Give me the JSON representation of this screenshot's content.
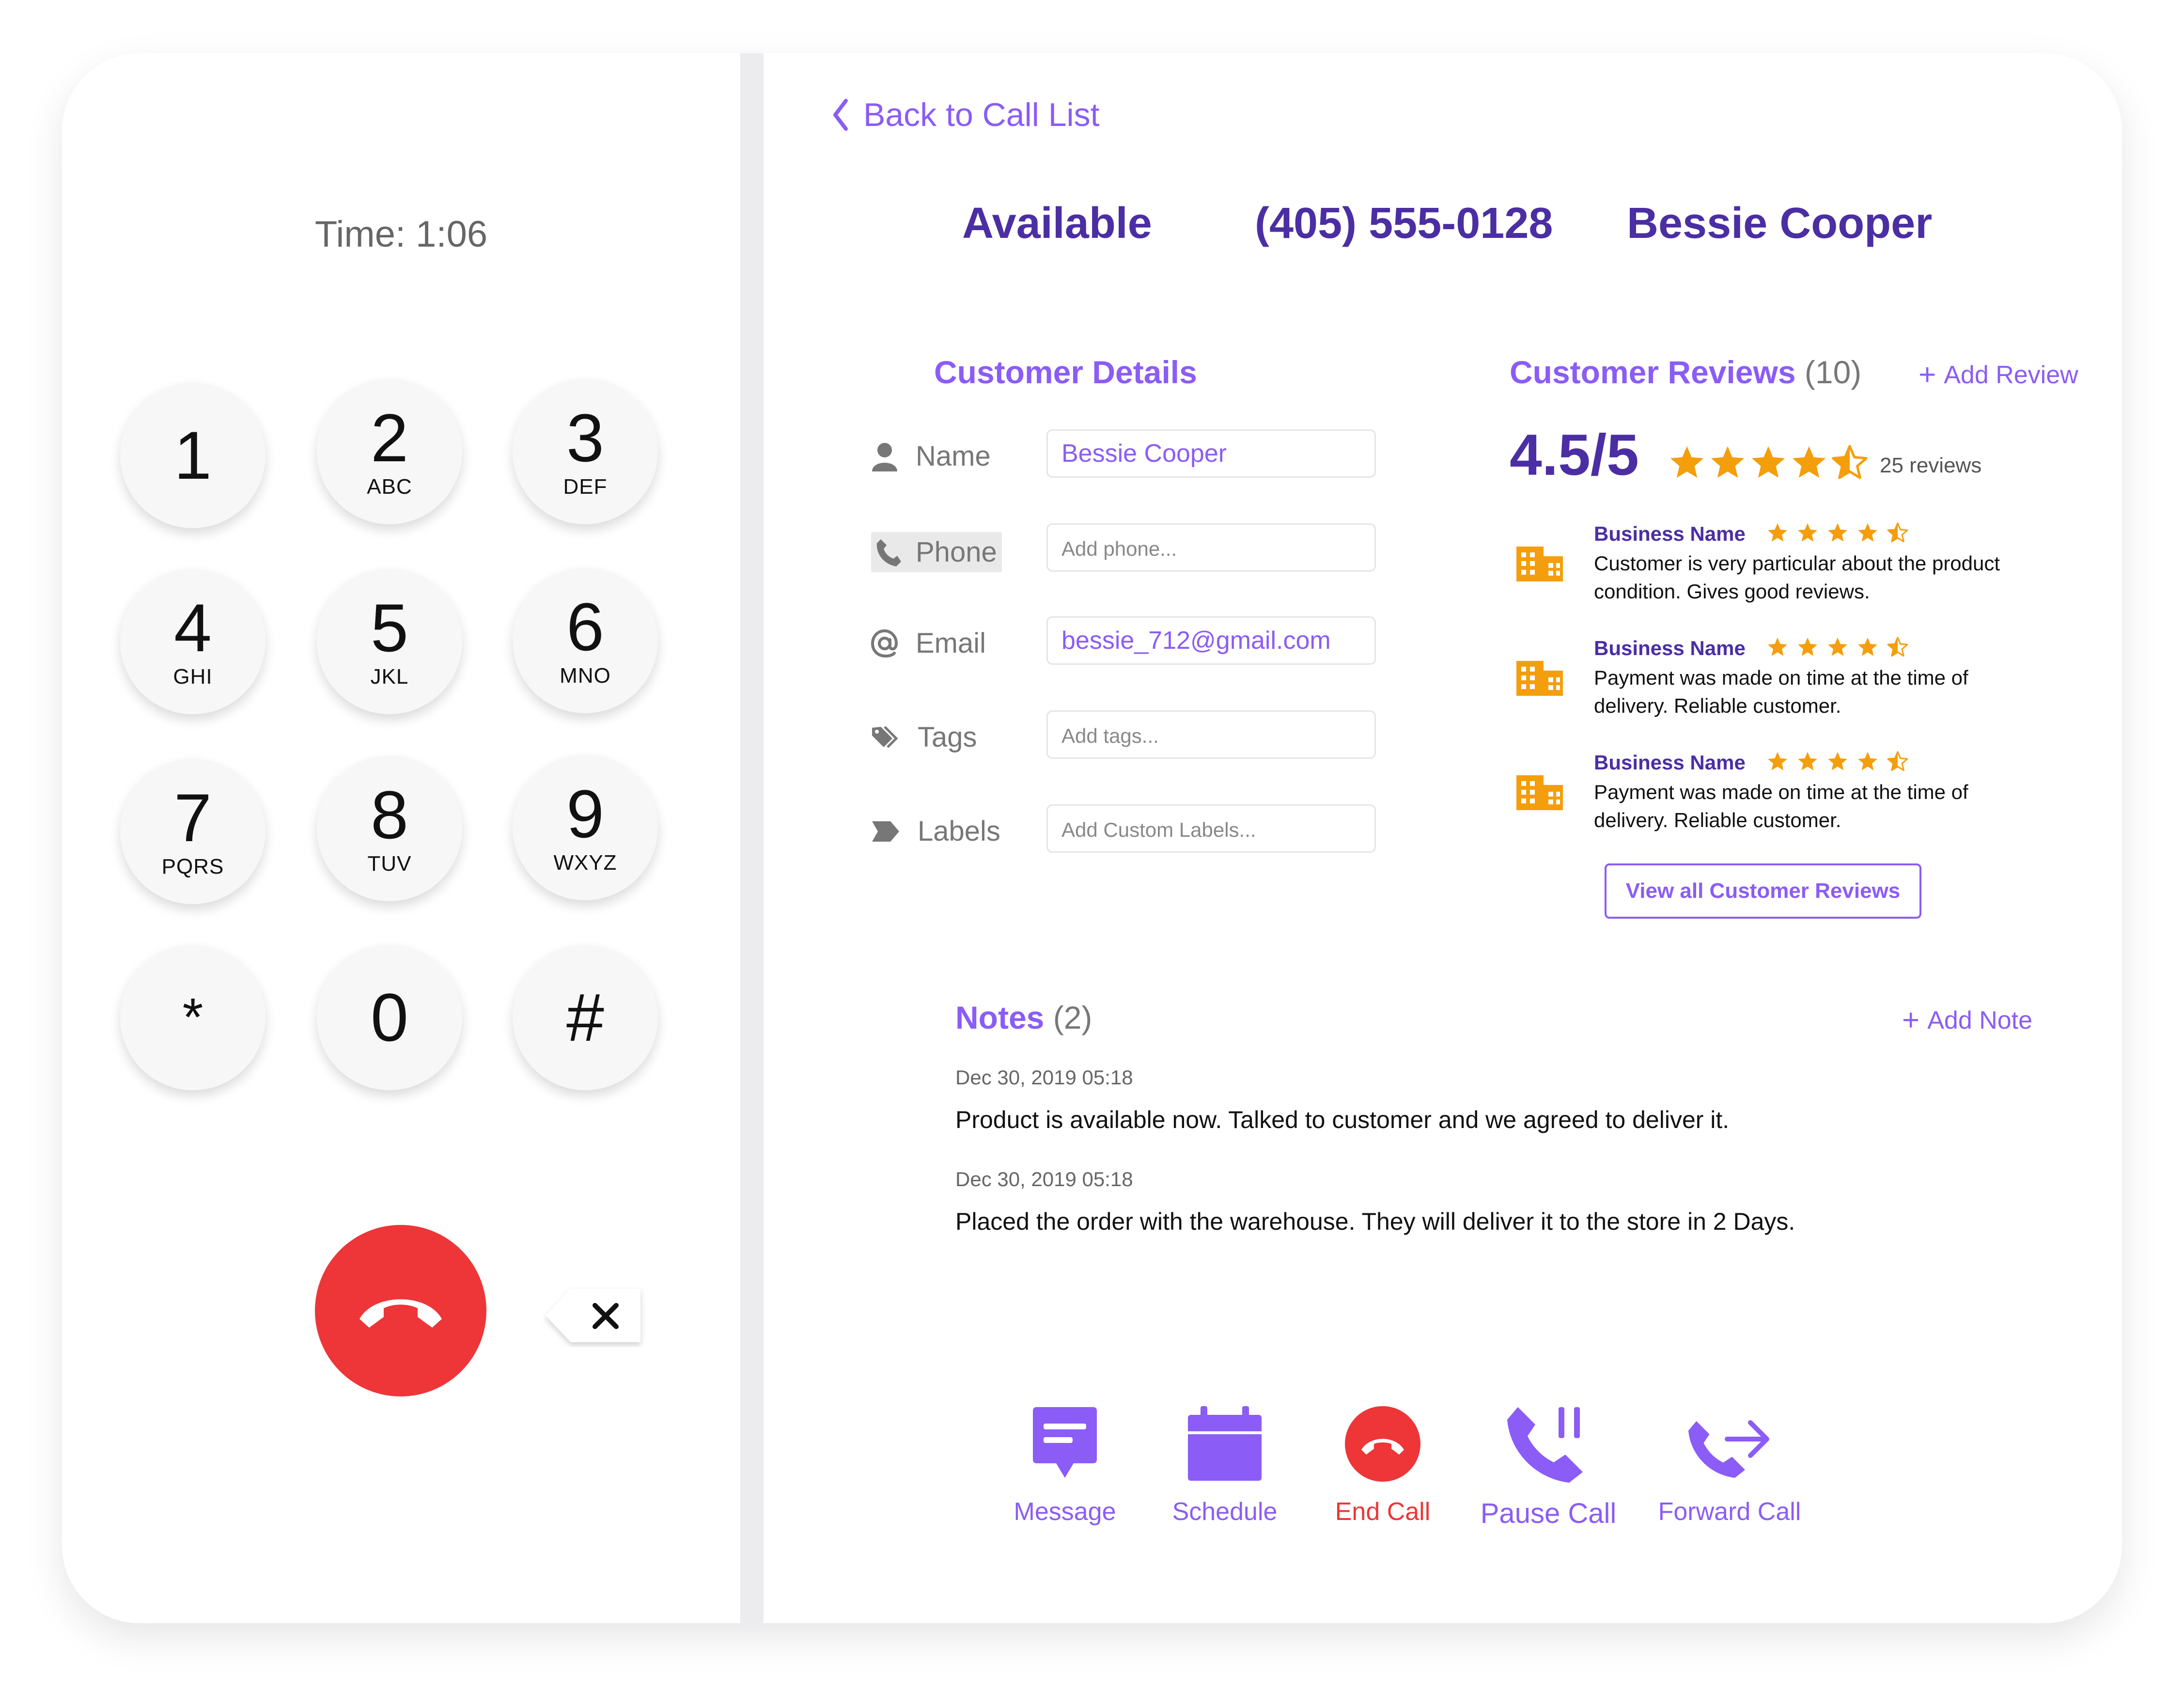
{
  "dialpad": {
    "timer": "Time: 1:06",
    "keys": [
      {
        "num": "1",
        "letters": ""
      },
      {
        "num": "2",
        "letters": "ABC"
      },
      {
        "num": "3",
        "letters": "DEF"
      },
      {
        "num": "4",
        "letters": "GHI"
      },
      {
        "num": "5",
        "letters": "JKL"
      },
      {
        "num": "6",
        "letters": "MNO"
      },
      {
        "num": "7",
        "letters": "PQRS"
      },
      {
        "num": "8",
        "letters": "TUV"
      },
      {
        "num": "9",
        "letters": "WXYZ"
      },
      {
        "num": "*",
        "letters": ""
      },
      {
        "num": "0",
        "letters": ""
      },
      {
        "num": "#",
        "letters": ""
      }
    ]
  },
  "header": {
    "back_label": "Back to Call List",
    "status": "Available",
    "phone": "(405) 555-0128",
    "contact_name": "Bessie Cooper"
  },
  "details": {
    "title": "Customer Details",
    "name_label": "Name",
    "name_value": "Bessie Cooper",
    "phone_label": "Phone",
    "phone_placeholder": "Add phone...",
    "email_label": "Email",
    "email_value": "bessie_712@gmail.com",
    "tags_label": "Tags",
    "tags_placeholder": "Add tags...",
    "labels_label": "Labels",
    "labels_placeholder": "Add Custom Labels..."
  },
  "reviews": {
    "title": "Customer Reviews",
    "count": "(10)",
    "add_label": "Add Review",
    "rating": "4.5/5",
    "rating_value": 4.5,
    "review_count": "25 reviews",
    "items": [
      {
        "business": "Business Name",
        "stars": 4.5,
        "text": "Customer is very particular about the product condition. Gives good reviews."
      },
      {
        "business": "Business Name",
        "stars": 4.5,
        "text": "Payment was made on time at the time of delivery. Reliable customer."
      },
      {
        "business": "Business Name",
        "stars": 4.5,
        "text": "Payment was made on time at the time of delivery. Reliable customer."
      }
    ],
    "view_all": "View all Customer Reviews"
  },
  "notes": {
    "title": "Notes",
    "count": "(2)",
    "add_label": "Add Note",
    "items": [
      {
        "date": "Dec 30, 2019 05:18",
        "text": "Product is available now. Talked to customer and we agreed to deliver it."
      },
      {
        "date": "Dec 30, 2019 05:18",
        "text": "Placed the order with the warehouse. They will deliver it to the store in 2 Days."
      }
    ]
  },
  "actions": {
    "message": "Message",
    "schedule": "Schedule",
    "end_call": "End Call",
    "pause_call": "Pause Call",
    "forward_call": "Forward Call"
  },
  "colors": {
    "accent": "#8b5cf6",
    "heading": "#4b2ea3",
    "danger": "#ee3537",
    "star": "#f59e0b",
    "business_icon": "#f59e0b"
  }
}
